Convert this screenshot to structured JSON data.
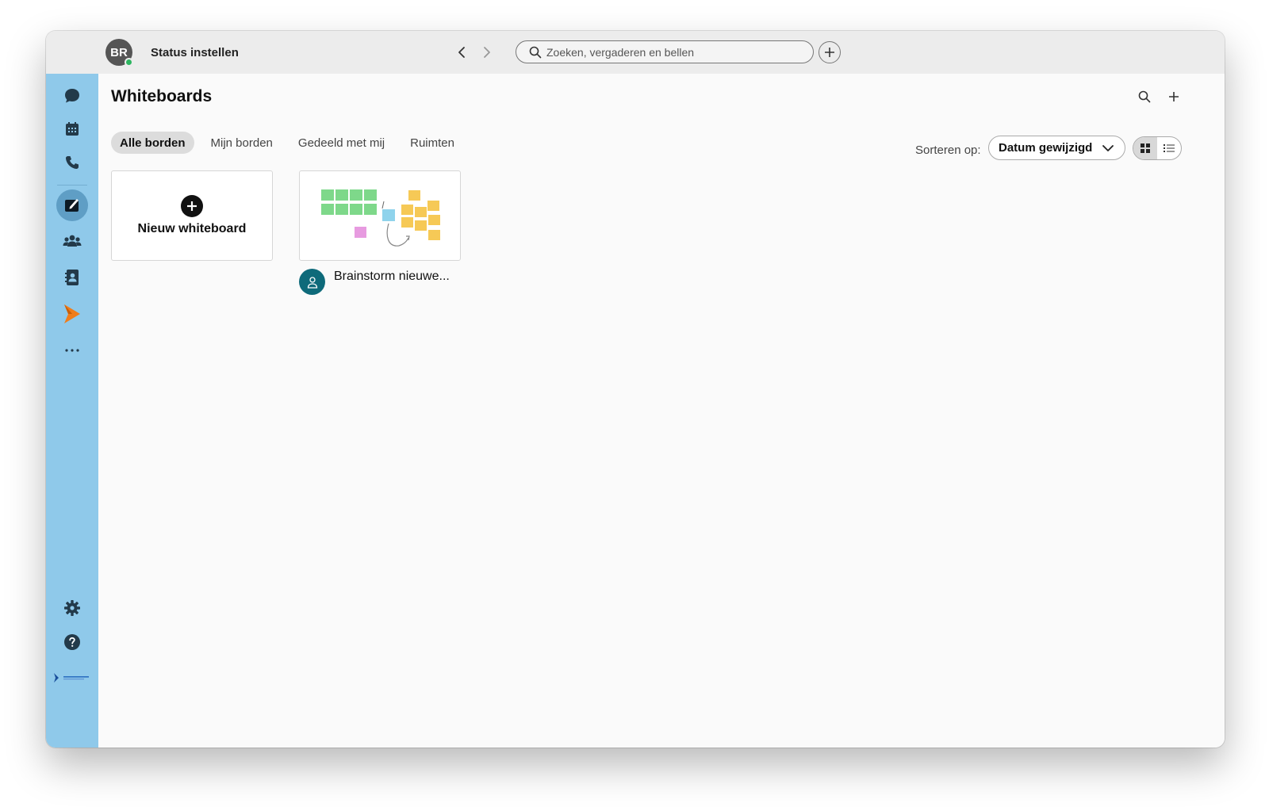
{
  "titlebar": {
    "avatar_initials": "BR",
    "status_label": "Status instellen",
    "search_placeholder": "Zoeken, vergaderen en bellen"
  },
  "sidebar": {
    "items": [
      {
        "icon": "chat-icon",
        "name": "messaging"
      },
      {
        "icon": "calendar-icon",
        "name": "meetings"
      },
      {
        "icon": "phone-icon",
        "name": "calling"
      },
      {
        "icon": "whiteboard-icon",
        "name": "whiteboards",
        "active": true
      },
      {
        "icon": "teams-icon",
        "name": "teams"
      },
      {
        "icon": "contacts-icon",
        "name": "contacts"
      },
      {
        "icon": "app-logo-icon",
        "name": "app"
      },
      {
        "icon": "more-icon",
        "name": "more"
      }
    ],
    "bottom": [
      {
        "icon": "gear-icon",
        "name": "settings"
      },
      {
        "icon": "help-icon",
        "name": "help"
      },
      {
        "icon": "brand-logo-icon",
        "name": "brand"
      }
    ]
  },
  "main": {
    "title": "Whiteboards",
    "tabs": [
      {
        "label": "Alle borden",
        "selected": true
      },
      {
        "label": "Mijn borden",
        "selected": false
      },
      {
        "label": "Gedeeld met mij",
        "selected": false
      },
      {
        "label": "Ruimten",
        "selected": false
      }
    ],
    "sort_label": "Sorteren op:",
    "sort_value": "Datum gewijzigd",
    "view_mode": "grid",
    "new_board_label": "Nieuw whiteboard",
    "boards": [
      {
        "name": "Brainstorm nieuwe..."
      }
    ]
  },
  "colors": {
    "sidebar": "#8fc9ea",
    "sidebar_active": "#5f9ec5",
    "presence": "#2db560",
    "board_avatar": "#0e6a7a",
    "app_logo": "#f07d1b"
  }
}
